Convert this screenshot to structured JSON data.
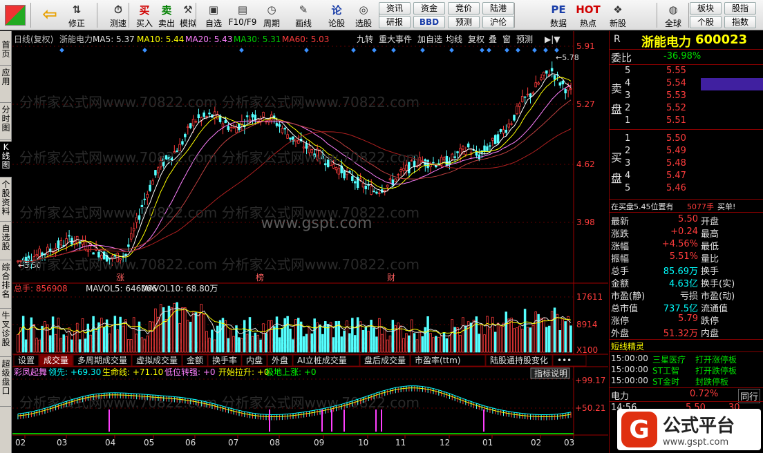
{
  "toolbar": {
    "items": [
      {
        "label": "",
        "icon": "grid-icon"
      },
      {
        "label": "",
        "icon": "back-arrow-icon"
      },
      {
        "label": "修正",
        "icon": "up-down-icon"
      },
      {
        "label": "测速",
        "icon": "speed-icon"
      },
      {
        "label": "买入",
        "icon": "buy-icon",
        "glyph": "买"
      },
      {
        "label": "卖出",
        "icon": "sell-icon",
        "glyph": "卖"
      },
      {
        "label": "模拟",
        "icon": "hammer-icon"
      },
      {
        "label": "自选",
        "icon": "folder-icon"
      },
      {
        "label": "F10/F9",
        "icon": "f10-icon"
      },
      {
        "label": "周期",
        "icon": "clock-icon"
      },
      {
        "label": "画线",
        "icon": "pen-icon"
      },
      {
        "label": "论股",
        "icon": "lun-icon",
        "glyph": "论"
      },
      {
        "label": "选股",
        "icon": "chart-select-icon"
      },
      {
        "label": "科创",
        "icon": "kechuang-icon"
      },
      {
        "label": "龙虎",
        "icon": "dragon-icon"
      },
      {
        "label": "数据",
        "icon": "pe-icon",
        "glyph": "PE"
      },
      {
        "label": "热点",
        "icon": "hot-icon",
        "glyph": "HOT"
      },
      {
        "label": "新股",
        "icon": "newstock-icon"
      },
      {
        "label": "全球",
        "icon": "globe-icon"
      }
    ],
    "buttons": [
      "资讯",
      "资金",
      "竞价",
      "陆港",
      "研报",
      "BBD",
      "预测",
      "沪伦",
      "板块",
      "股指",
      "个股",
      "指数"
    ]
  },
  "left_tabs": [
    "首页",
    "应用",
    "分时图",
    "K线图",
    "个股资料",
    "自选股",
    "综合排名",
    "牛叉诊股",
    "超级盘口"
  ],
  "chart": {
    "header": {
      "period": "日线(复权)",
      "name": "浙能电力",
      "ma5": "MA5: 5.37",
      "ma10": "MA10: 5.44",
      "ma20": "MA20: 5.43",
      "ma30": "MA30: 5.31",
      "ma60": "MA60: 5.03"
    },
    "header_buttons": [
      "九转",
      "重大事件",
      "加自选",
      "均线",
      "复权",
      "叠",
      "窗",
      "预测"
    ],
    "price_axis": [
      "5.91",
      "5.27",
      "4.62",
      "3.98"
    ],
    "high_label": "5.78",
    "low_label": "3.50",
    "event_marks": [
      "涨",
      "榜",
      "财"
    ],
    "watermarks": [
      "分析家公式网www.70822.com",
      "www.gspt.com"
    ],
    "vol_header": {
      "total": "总手: 856908",
      "mavol5": "MAVOL5: 646066",
      "mavol10": "MAVOL10: 68.80万"
    },
    "vol_axis": [
      "17611",
      "8914",
      "X100"
    ],
    "indicator_tabs": [
      "设置",
      "成交量",
      "多周期成交量",
      "虚拟成交量",
      "金额",
      "换手率",
      "内盘",
      "外盘",
      "AI立桩成交量",
      "盘后成交量",
      "市盈率(ttm)",
      "陆股通持股变化",
      "•••"
    ],
    "ind_header": {
      "name": "彩凤起舞",
      "lead": "领先: +69.30",
      "life": "生命线: +71.10",
      "low": "低位转强: +0",
      "start": "开始拉升: +0",
      "ground": "极地上涨: +0"
    },
    "ind_help": "指标说明",
    "ind_axis": [
      "+99.17",
      "+50.21"
    ],
    "months": [
      "02",
      "03",
      "04",
      "05",
      "06",
      "07",
      "08",
      "09",
      "10",
      "11",
      "12",
      "01",
      "02",
      "03"
    ]
  },
  "quote": {
    "code_r": "R",
    "name": "浙能电力",
    "code": "600023",
    "weibi_label": "委比",
    "weibi": "-36.98%",
    "sell_label": [
      "卖",
      "盘"
    ],
    "buy_label": [
      "买",
      "盘"
    ],
    "asks": [
      {
        "lvl": "5",
        "p": "5.55"
      },
      {
        "lvl": "4",
        "p": "5.54"
      },
      {
        "lvl": "3",
        "p": "5.53"
      },
      {
        "lvl": "2",
        "p": "5.52"
      },
      {
        "lvl": "1",
        "p": "5.51"
      }
    ],
    "bids": [
      {
        "lvl": "1",
        "p": "5.50"
      },
      {
        "lvl": "2",
        "p": "5.49"
      },
      {
        "lvl": "3",
        "p": "5.48"
      },
      {
        "lvl": "4",
        "p": "5.47"
      },
      {
        "lvl": "5",
        "p": "5.46"
      }
    ],
    "notice": "在买盘5.45位置有",
    "notice_vol": "5077手",
    "notice_act": "买单!",
    "stats": [
      {
        "l": "最新",
        "v": "5.50",
        "l2": "开盘"
      },
      {
        "l": "涨跌",
        "v": "+0.24",
        "l2": "最高"
      },
      {
        "l": "涨幅",
        "v": "+4.56%",
        "l2": "最低"
      },
      {
        "l": "振幅",
        "v": "5.51%",
        "l2": "量比"
      },
      {
        "l": "总手",
        "v": "85.69万",
        "l2": "换手"
      },
      {
        "l": "金额",
        "v": "4.63亿",
        "l2": "换手(实)"
      },
      {
        "l": "市盈(静)",
        "v": "亏损",
        "l2": "市盈(动)"
      },
      {
        "l": "总市值",
        "v": "737.5亿",
        "l2": "流通值"
      },
      {
        "l": "涨停",
        "v": "5.79",
        "l2": "跌停"
      },
      {
        "l": "外盘",
        "v": "51.32万",
        "l2": "内盘"
      }
    ],
    "elf_title": "短线精灵",
    "elf": [
      {
        "t": "15:00:00",
        "n": "三星医疗",
        "a": "打开涨停板"
      },
      {
        "t": "15:00:00",
        "n": "ST工智",
        "a": "打开跌停板"
      },
      {
        "t": "15:00:00",
        "n": "ST金时",
        "a": "封跌停板"
      }
    ],
    "sector_label": "电力",
    "sector_pct": "0.72%",
    "sector_btn": "同行",
    "tick_time": "14:56",
    "tick_price": "5.50",
    "tick_vol": "30"
  },
  "logo": {
    "text": "公式平台",
    "url": "www.gspt.com"
  },
  "colors": {
    "up": "#ff3c3c",
    "down": "#54ffff",
    "ma5": "#ffffff",
    "ma10": "#ffff00",
    "ma20": "#ff80ff",
    "ma30": "#00ff00",
    "ma60": "#b02020"
  }
}
